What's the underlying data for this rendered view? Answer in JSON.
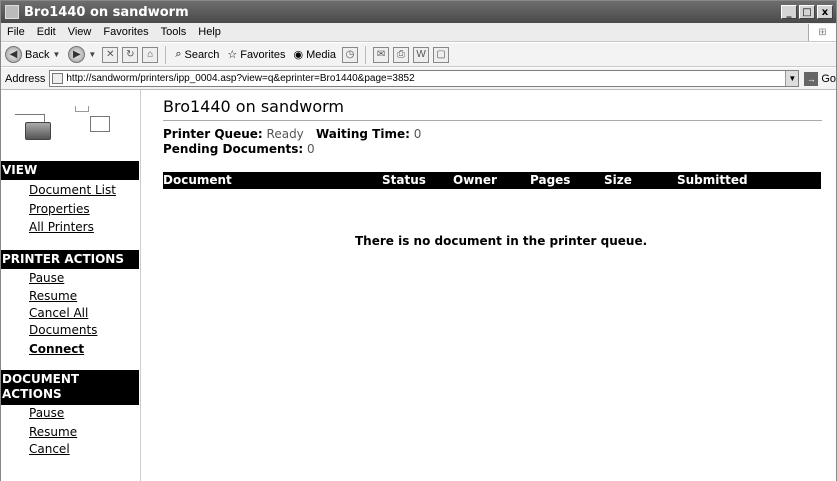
{
  "window": {
    "title": "Bro1440 on sandworm",
    "buttons": [
      "_",
      "□",
      "x"
    ]
  },
  "menu": [
    "File",
    "Edit",
    "View",
    "Favorites",
    "Tools",
    "Help"
  ],
  "toolbar": {
    "back": "Back",
    "search": "Search",
    "favorites": "Favorites",
    "media": "Media"
  },
  "address": {
    "label": "Address",
    "url": "http://sandworm/printers/ipp_0004.asp?view=q&eprinter=Bro1440&page=3852",
    "go": "Go"
  },
  "sidebar": {
    "view_header": "VIEW",
    "view_items": [
      "Document List",
      "Properties",
      "All Printers"
    ],
    "printer_header": "PRINTER ACTIONS",
    "printer_items": [
      "Pause",
      "Resume",
      "Cancel All",
      "Documents",
      "Connect"
    ],
    "document_header_1": "DOCUMENT",
    "document_header_2": "ACTIONS",
    "document_items": [
      "Pause",
      "Resume",
      "Cancel"
    ]
  },
  "main": {
    "title": "Bro1440 on sandworm",
    "queue_label": "Printer Queue:",
    "queue_value": "Ready",
    "waiting_label": "Waiting Time:",
    "waiting_value": "0",
    "pending_label": "Pending Documents:",
    "pending_value": "0",
    "columns": [
      "Document",
      "Status",
      "Owner",
      "Pages",
      "Size",
      "Submitted"
    ],
    "empty_message": "There is no document in the printer queue."
  }
}
